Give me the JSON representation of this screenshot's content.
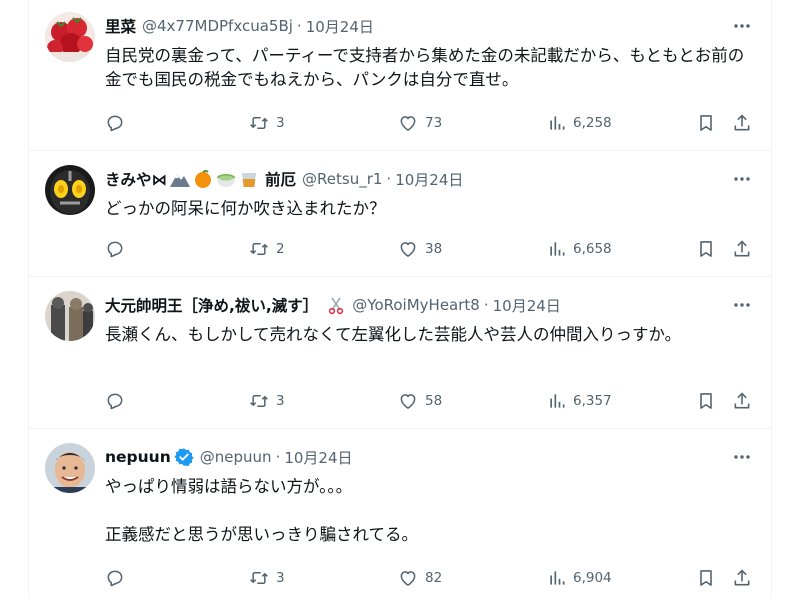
{
  "tweets": [
    {
      "name": "里菜",
      "handle": "@4x77MDPfxcua5Bj",
      "dot": "·",
      "date": "10月24日",
      "text": "自民党の裏金って、パーティーで支持者から集めた金の未記載だから、もともとお前の金でも国民の税金でもねえから、パンクは自分で直せ。",
      "replies": "",
      "retweets": "3",
      "likes": "73",
      "views": "6,258"
    },
    {
      "name": "きみや⋈",
      "name_suffix": "前厄",
      "handle": "@Retsu_r1",
      "dot": "·",
      "date": "10月24日",
      "text": "どっかの阿呆に何か吹き込まれたか？",
      "replies": "",
      "retweets": "2",
      "likes": "38",
      "views": "6,658"
    },
    {
      "name": "大元帥明王［浄め,祓い,滅す］",
      "handle": "@YoRoiMyHeart8",
      "dot": "·",
      "date": "10月24日",
      "text": "長瀬くん、もしかして売れなくて左翼化した芸能人や芸人の仲間入りっすか。",
      "replies": "",
      "retweets": "3",
      "likes": "58",
      "views": "6,357"
    },
    {
      "name": "nepuun",
      "handle": "@nepuun",
      "dot": "·",
      "date": "10月24日",
      "text": "やっぱり情弱は語らない方が。。。\n\n正義感だと思うが思いっきり騙されてる。",
      "replies": "",
      "retweets": "3",
      "likes": "82",
      "views": "6,904"
    }
  ],
  "icons": {
    "reply": "reply-icon",
    "retweet": "retweet-icon",
    "like": "heart-icon",
    "views": "views-icon",
    "bookmark": "bookmark-icon",
    "share": "share-icon",
    "more": "more-icon",
    "verified": "verified-badge-icon"
  },
  "colors": {
    "text": "#0f1419",
    "secondary": "#536471",
    "border": "#eff3f4",
    "verified": "#1d9bf0"
  }
}
